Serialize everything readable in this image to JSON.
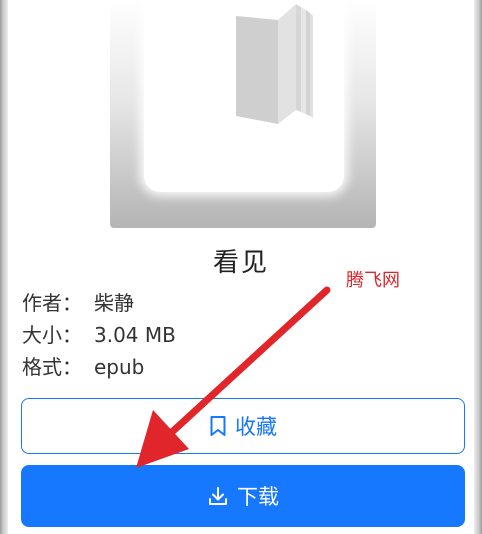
{
  "book": {
    "title": "看见",
    "cover_icon": "book-icon"
  },
  "meta": {
    "author": {
      "label": "作者：",
      "value": "柴静"
    },
    "size": {
      "label": "大小：",
      "value": "3.04 MB"
    },
    "format": {
      "label": "格式：",
      "value": "epub"
    }
  },
  "actions": {
    "favorite": {
      "label": "收藏",
      "icon": "bookmark-icon"
    },
    "download": {
      "label": "下载",
      "icon": "download-icon"
    }
  },
  "watermark": {
    "text": "腾飞网"
  },
  "colors": {
    "primary": "#1677ff",
    "annotation_red": "#e0262b"
  }
}
